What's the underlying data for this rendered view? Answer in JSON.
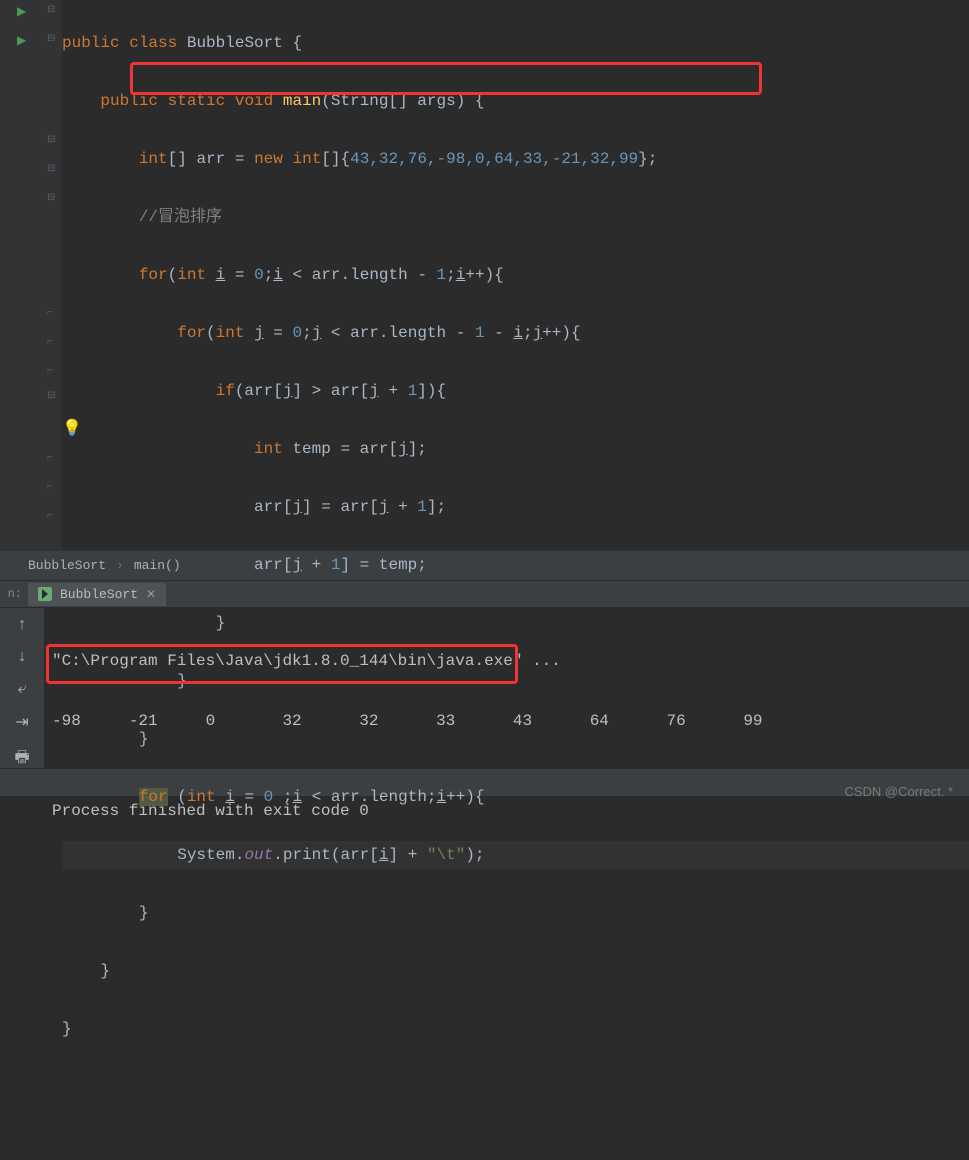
{
  "code": {
    "kw_public": "public",
    "kw_class": "class",
    "cls_name": "BubbleSort",
    "kw_static": "static",
    "kw_void": "void",
    "fn_main": "main",
    "type_string": "String",
    "args": "args",
    "kw_int": "int",
    "var_arr": "arr",
    "kw_new": "new",
    "arr_values": "43,32,76,-98,0,64,33,-21,32,99",
    "comment": "//冒泡排序",
    "kw_for": "for",
    "var_i": "i",
    "var_j": "j",
    "num_0": "0",
    "num_1": "1",
    "length": "length",
    "kw_if": "if",
    "var_temp": "temp",
    "sys": "System",
    "out": "out",
    "print": "print",
    "str_tab": "\"\\t\""
  },
  "breadcrumbs": {
    "class": "BubbleSort",
    "method": "main()"
  },
  "runTab": {
    "name": "BubbleSort",
    "label": "n:"
  },
  "console": {
    "line1": "\"C:\\Program Files\\Java\\jdk1.8.0_144\\bin\\java.exe\" ...",
    "line2": "-98\t-21\t0\t32\t32\t33\t43\t64\t76\t99\t",
    "line3": "",
    "line4": "Process finished with exit code 0"
  },
  "watermark": "CSDN @Correct. *"
}
